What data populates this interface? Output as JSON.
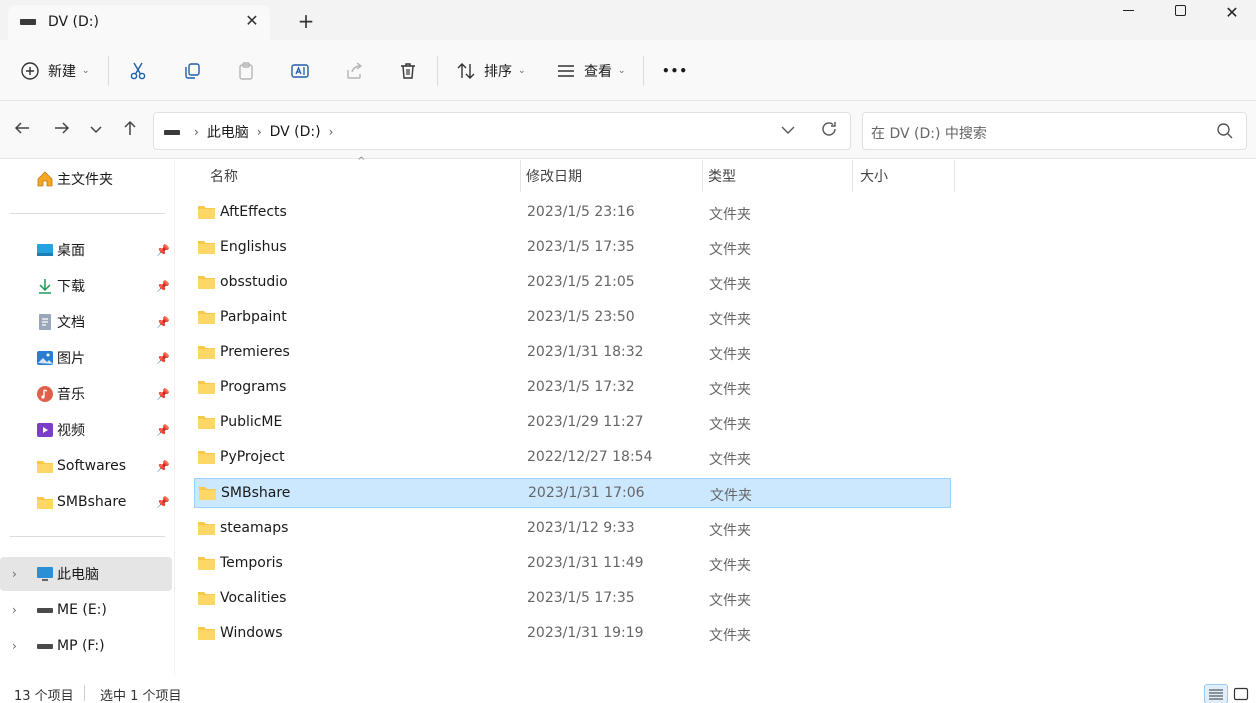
{
  "window": {
    "tab_title": "DV (D:)",
    "tab_close": "✕",
    "tab_add": "+",
    "close_glyph": "✕"
  },
  "commandbar": {
    "new_label": "新建",
    "sort_label": "排序",
    "view_label": "查看",
    "more_label": "•••",
    "caret": "⌄"
  },
  "address": {
    "crumbs": [
      "此电脑",
      "DV (D:)"
    ],
    "separator": "›",
    "search_placeholder": "在 DV (D:) 中搜索"
  },
  "sidebar": {
    "home": "主文件夹",
    "quick_access": [
      {
        "label": "桌面",
        "icon": "desktop-icon"
      },
      {
        "label": "下载",
        "icon": "download-icon"
      },
      {
        "label": "文档",
        "icon": "document-icon"
      },
      {
        "label": "图片",
        "icon": "pictures-icon"
      },
      {
        "label": "音乐",
        "icon": "music-icon"
      },
      {
        "label": "视频",
        "icon": "video-icon"
      },
      {
        "label": "Softwares",
        "icon": "folder-icon"
      },
      {
        "label": "SMBshare",
        "icon": "folder-icon"
      }
    ],
    "this_pc": "此电脑",
    "drives": [
      "ME (E:)",
      "MP (F:)"
    ]
  },
  "columns": {
    "name": "名称",
    "date": "修改日期",
    "type": "类型",
    "size": "大小"
  },
  "files": [
    {
      "name": "AftEffects",
      "date": "2023/1/5 23:16",
      "type": "文件夹"
    },
    {
      "name": "Englishus",
      "date": "2023/1/5 17:35",
      "type": "文件夹"
    },
    {
      "name": "obsstudio",
      "date": "2023/1/5 21:05",
      "type": "文件夹"
    },
    {
      "name": "Parbpaint",
      "date": "2023/1/5 23:50",
      "type": "文件夹"
    },
    {
      "name": "Premieres",
      "date": "2023/1/31 18:32",
      "type": "文件夹"
    },
    {
      "name": "Programs",
      "date": "2023/1/5 17:32",
      "type": "文件夹"
    },
    {
      "name": "PublicME",
      "date": "2023/1/29 11:27",
      "type": "文件夹"
    },
    {
      "name": "PyProject",
      "date": "2022/12/27 18:54",
      "type": "文件夹"
    },
    {
      "name": "SMBshare",
      "date": "2023/1/31 17:06",
      "type": "文件夹",
      "selected": true
    },
    {
      "name": "steamaps",
      "date": "2023/1/12 9:33",
      "type": "文件夹"
    },
    {
      "name": "Temporis",
      "date": "2023/1/31 11:49",
      "type": "文件夹"
    },
    {
      "name": "Vocalities",
      "date": "2023/1/5 17:35",
      "type": "文件夹"
    },
    {
      "name": "Windows",
      "date": "2023/1/31 19:19",
      "type": "文件夹"
    }
  ],
  "status": {
    "count": "13 个项目",
    "selected": "选中 1 个项目"
  },
  "colors": {
    "selection_bg": "#cce8ff",
    "selection_border": "#99d1ff",
    "folder_yellow": "#f8c84a"
  }
}
